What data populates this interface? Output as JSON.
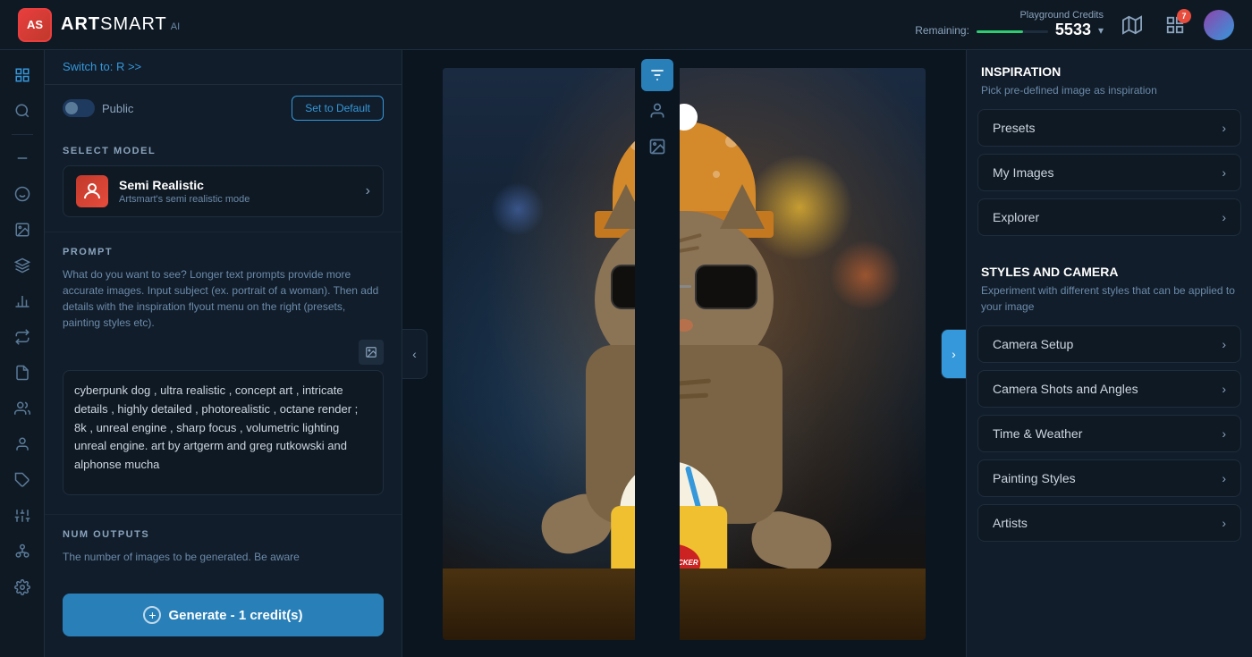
{
  "header": {
    "logo_initials": "AS",
    "logo_name_bold": "ART",
    "logo_name_light": "SMART",
    "logo_ai": "AI",
    "credits_label": "Playground Credits",
    "credits_remaining_label": "Remaining:",
    "credits_amount": "5533",
    "notification_count": "7",
    "credits_bar_pct": 65
  },
  "switch_to": "Switch to: R >>",
  "top_controls": {
    "toggle_label": "Public",
    "set_default_btn": "Set to Default"
  },
  "model_section": {
    "title": "SELECT MODEL",
    "model_name": "Semi Realistic",
    "model_desc": "Artsmart's semi realistic mode"
  },
  "prompt_section": {
    "title": "PROMPT",
    "description": "What do you want to see? Longer text prompts provide more accurate images. Input subject (ex. portrait of a woman). Then add details with the inspiration flyout menu on the right (presets, painting styles etc).",
    "text_value": "cyberpunk dog , ultra realistic , concept art , intricate details , highly detailed , photorealistic , octane render ; 8k , unreal engine , sharp focus , volumetric lighting unreal engine. art by artgerm and greg rutkowski and alphonse mucha"
  },
  "num_outputs_section": {
    "title": "NUM OUTPUTS",
    "description": "The number of images to be generated. Be aware"
  },
  "generate_btn": "Generate - 1 credit(s)",
  "right_panel": {
    "inspiration_title": "INSPIRATION",
    "inspiration_desc": "Pick pre-defined image as inspiration",
    "accordions_inspiration": [
      {
        "label": "Presets"
      },
      {
        "label": "My Images"
      },
      {
        "label": "Explorer"
      }
    ],
    "styles_title": "STYLES AND CAMERA",
    "styles_desc": "Experiment with different styles that can be applied to your image",
    "accordions_styles": [
      {
        "label": "Camera Setup"
      },
      {
        "label": "Camera Shots and Angles"
      },
      {
        "label": "Time & Weather"
      },
      {
        "label": "Painting Styles"
      },
      {
        "label": "Artists"
      }
    ]
  },
  "sidebar_icons": [
    {
      "name": "grid-icon",
      "symbol": "⊞"
    },
    {
      "name": "search-icon",
      "symbol": "🔍"
    },
    {
      "name": "minus-icon",
      "symbol": "—"
    },
    {
      "name": "user-face-icon",
      "symbol": "😊"
    },
    {
      "name": "image-icon",
      "symbol": "🖼"
    },
    {
      "name": "layers-icon",
      "symbol": "◧"
    },
    {
      "name": "chart-icon",
      "symbol": "📈"
    },
    {
      "name": "transfer-icon",
      "symbol": "⇄"
    },
    {
      "name": "document-icon",
      "symbol": "📄"
    },
    {
      "name": "group-icon",
      "symbol": "👥"
    },
    {
      "name": "person-icon",
      "symbol": "👤"
    },
    {
      "name": "puzzle-icon",
      "symbol": "🧩"
    },
    {
      "name": "sliders-icon",
      "symbol": "🎚"
    },
    {
      "name": "network-icon",
      "symbol": "🔗"
    },
    {
      "name": "settings-icon",
      "symbol": "⚙"
    }
  ],
  "strip_icons": [
    {
      "name": "filter-icon",
      "symbol": "≡",
      "active": true
    },
    {
      "name": "person2-icon",
      "symbol": "⬛"
    },
    {
      "name": "photo-icon",
      "symbol": "🖼"
    }
  ],
  "cup_logo_text": "hbeh\nSUCKER"
}
